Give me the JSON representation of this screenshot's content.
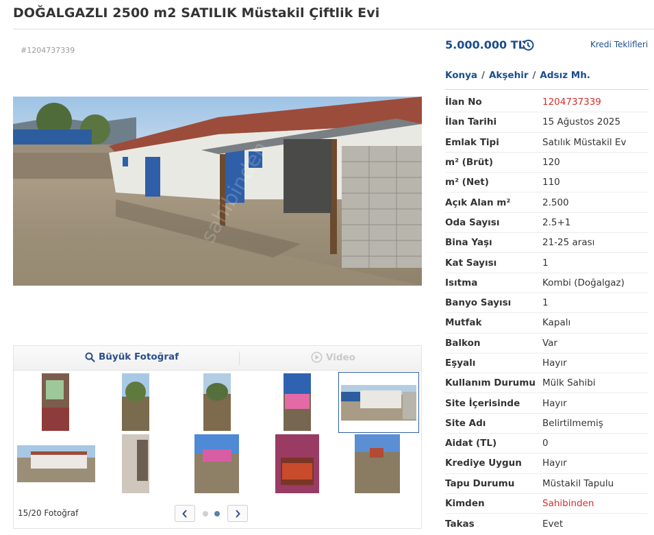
{
  "title": "DOĞALGAZLI 2500 m2 SATILIK Müstakil Çiftlik Evi",
  "listing_id_tag": "#1204737339",
  "price": "5.000.000 TL",
  "loan_link": "Kredi Teklifleri",
  "breadcrumb": {
    "city": "Konya",
    "district": "Akşehir",
    "neighborhood": "Adsız Mh.",
    "sep": "/"
  },
  "media": {
    "photo_button": "Büyük Fotoğraf",
    "video_button": "Video"
  },
  "gallery": {
    "counter": "15/20 Fotoğraf"
  },
  "details": [
    {
      "k": "İlan No",
      "v": "1204737339",
      "red": true
    },
    {
      "k": "İlan Tarihi",
      "v": "15 Ağustos 2025"
    },
    {
      "k": "Emlak Tipi",
      "v": "Satılık Müstakil Ev"
    },
    {
      "k": "m² (Brüt)",
      "v": "120"
    },
    {
      "k": "m² (Net)",
      "v": "110"
    },
    {
      "k": "Açık Alan m²",
      "v": "2.500"
    },
    {
      "k": "Oda Sayısı",
      "v": "2.5+1"
    },
    {
      "k": "Bina Yaşı",
      "v": "21-25 arası"
    },
    {
      "k": "Kat Sayısı",
      "v": "1"
    },
    {
      "k": "Isıtma",
      "v": "Kombi (Doğalgaz)"
    },
    {
      "k": "Banyo Sayısı",
      "v": "1"
    },
    {
      "k": "Mutfak",
      "v": "Kapalı"
    },
    {
      "k": "Balkon",
      "v": "Var"
    },
    {
      "k": "Eşyalı",
      "v": "Hayır"
    },
    {
      "k": "Kullanım Durumu",
      "v": "Mülk Sahibi"
    },
    {
      "k": "Site İçerisinde",
      "v": "Hayır"
    },
    {
      "k": "Site Adı",
      "v": "Belirtilmemiş"
    },
    {
      "k": "Aidat (TL)",
      "v": "0"
    },
    {
      "k": "Krediye Uygun",
      "v": "Hayır"
    },
    {
      "k": "Tapu Durumu",
      "v": "Müstakil Tapulu"
    },
    {
      "k": "Kimden",
      "v": "Sahibinden",
      "red": true
    },
    {
      "k": "Takas",
      "v": "Evet"
    }
  ],
  "colors": {
    "link_blue": "#1a4d8e",
    "accent_red": "#d62c2c",
    "selected_border": "#2d5ea1"
  }
}
